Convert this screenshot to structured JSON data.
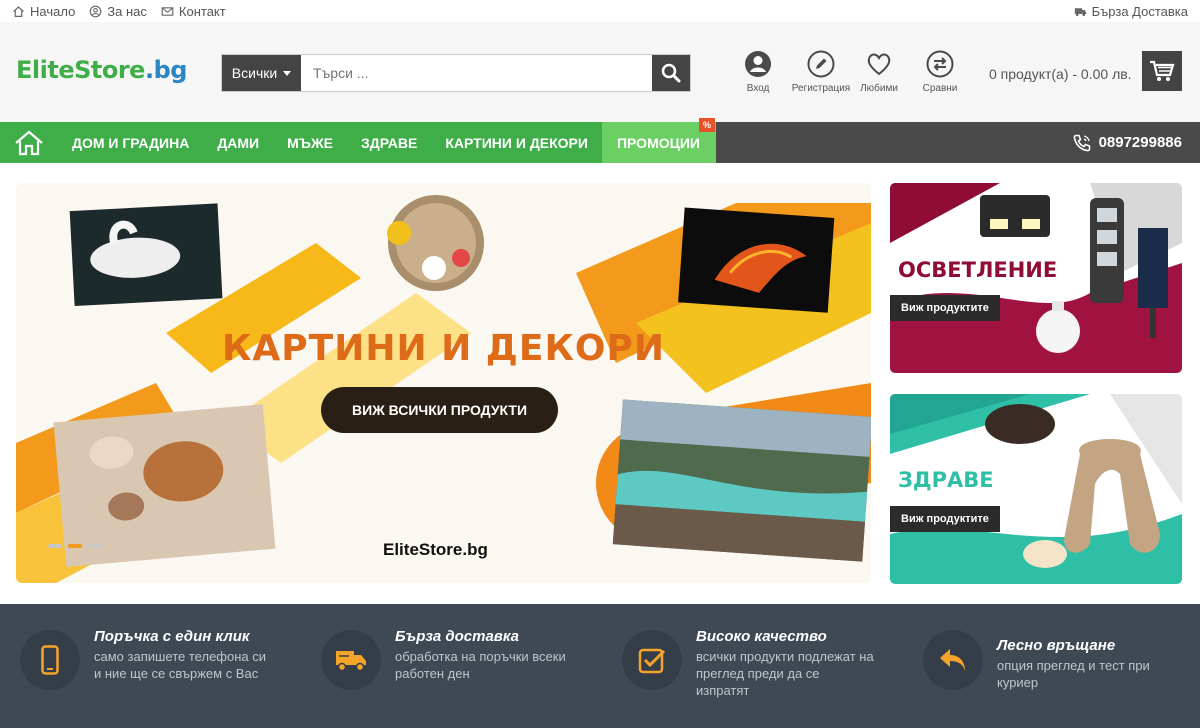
{
  "topbar": {
    "home": "Начало",
    "about": "За нас",
    "contact": "Контакт",
    "delivery": "Бърза Доставка"
  },
  "header": {
    "logo_part1": "EliteStore",
    "logo_part2": ".bg",
    "search_category": "Всички",
    "search_placeholder": "Търси ...",
    "login": "Вход",
    "register": "Регистрация",
    "favorites": "Любими",
    "compare": "Сравни",
    "cart_summary": "0 продукт(а) - 0.00 лв."
  },
  "nav": {
    "items": [
      "ДОМ И ГРАДИНА",
      "ДАМИ",
      "МЪЖЕ",
      "ЗДРАВЕ",
      "КАРТИНИ И ДЕКОРИ"
    ],
    "promo": "ПРОМОЦИИ",
    "promo_badge": "%",
    "phone": "0897299886"
  },
  "hero": {
    "title": "КАРТИНИ И ДЕКОРИ",
    "button": "ВИЖ ВСИЧКИ ПРОДУКТИ",
    "brand": "EliteStore.bg"
  },
  "side_banners": [
    {
      "title": "ОСВЕТЛЕНИЕ",
      "button": "Виж продуктите",
      "accent": "#a0123f"
    },
    {
      "title": "ЗДРАВЕ",
      "button": "Виж продуктите",
      "accent": "#2fbfa6"
    }
  ],
  "features": [
    {
      "title": "Поръчка с един клик",
      "text": "само запишете телефона си и ние ще се свържем с Вас",
      "icon": "phone-icon"
    },
    {
      "title": "Бърза доставка",
      "text": "обработка на поръчки всеки работен ден",
      "icon": "truck-icon"
    },
    {
      "title": "Високо качество",
      "text": "всички продукти подлежат на преглед преди да се изпратят",
      "icon": "check-icon"
    },
    {
      "title": "Лесно връщане",
      "text": "опция преглед и тест при куриер",
      "icon": "return-icon"
    }
  ],
  "colors": {
    "green": "#3fae49",
    "light_green": "#6ccf64",
    "dark": "#444444",
    "orange": "#f39a1c",
    "feature_bg": "#3f4954"
  }
}
